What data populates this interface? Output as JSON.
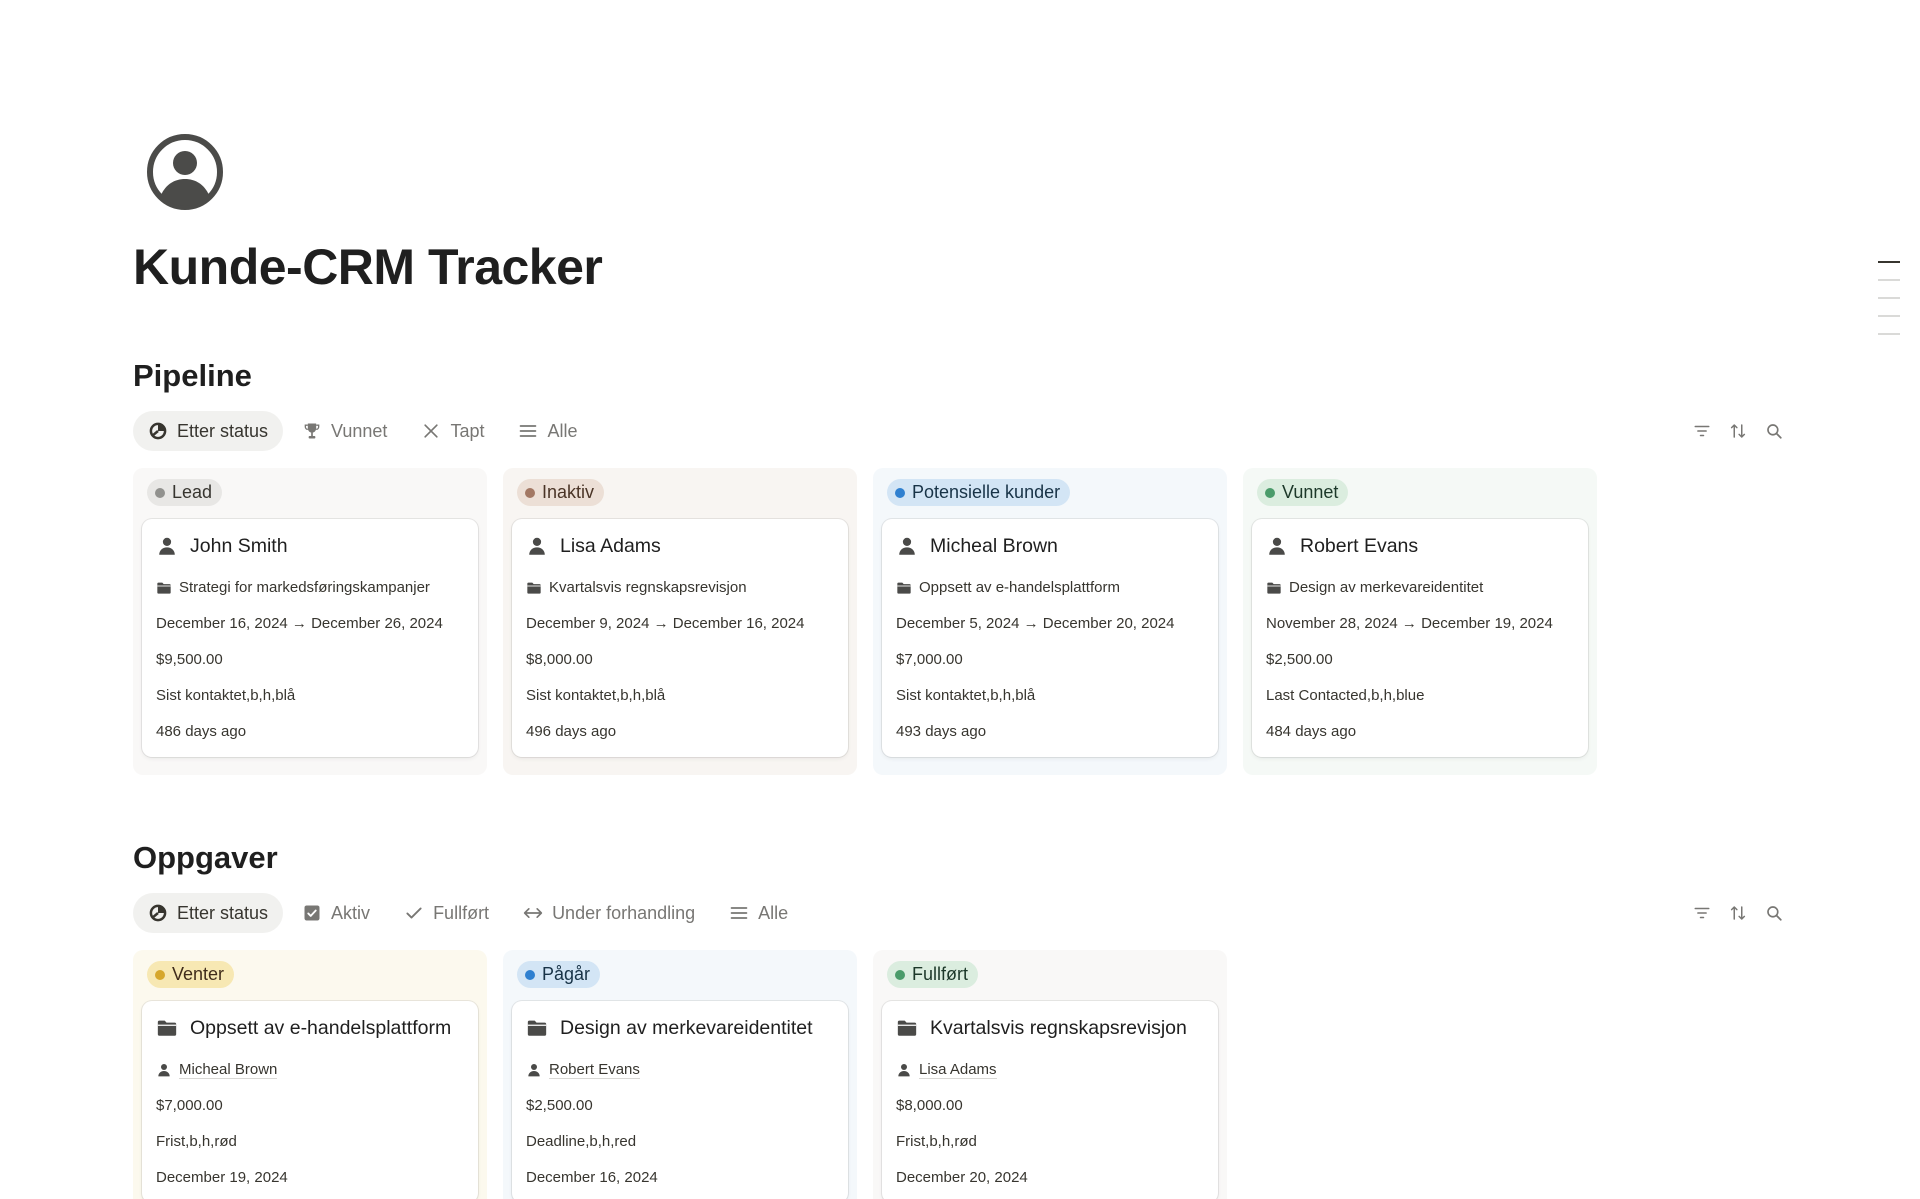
{
  "page": {
    "title": "Kunde-CRM Tracker",
    "icon": "user-circle-icon"
  },
  "pipeline": {
    "title": "Pipeline",
    "tabs": [
      {
        "label": "Etter status",
        "icon": "status-icon",
        "active": true
      },
      {
        "label": "Vunnet",
        "icon": "trophy-icon",
        "active": false
      },
      {
        "label": "Tapt",
        "icon": "x-icon",
        "active": false
      },
      {
        "label": "Alle",
        "icon": "list-icon",
        "active": false
      }
    ],
    "toolbar": [
      "filter-icon",
      "sort-icon",
      "search-icon"
    ],
    "columns": [
      {
        "label": "Lead",
        "color": "#91918e",
        "cards": [
          {
            "name": "John Smith",
            "project": "Strategi for markedsføringskampanjer",
            "dates": "December 16, 2024 → December 26, 2024",
            "value": "$9,500.00",
            "contact": "Sist kontaktet,b,h,blå",
            "age": "486 days ago"
          }
        ]
      },
      {
        "label": "Inaktiv",
        "color": "#a27763",
        "cards": [
          {
            "name": "Lisa Adams",
            "project": "Kvartalsvis regnskapsrevisjon",
            "dates": "December 9, 2024 → December 16, 2024",
            "value": "$8,000.00",
            "contact": "Sist kontaktet,b,h,blå",
            "age": "496 days ago"
          }
        ]
      },
      {
        "label": "Potensielle kunder",
        "color": "#2f80d0",
        "cards": [
          {
            "name": "Micheal Brown",
            "project": "Oppsett av e-handelsplattform",
            "dates": "December 5, 2024 → December 20, 2024",
            "value": "$7,000.00",
            "contact": "Sist kontaktet,b,h,blå",
            "age": "493 days ago"
          }
        ]
      },
      {
        "label": "Vunnet",
        "color": "#4a9b6a",
        "cards": [
          {
            "name": "Robert Evans",
            "project": "Design av merkevareidentitet",
            "dates": "November 28, 2024 → December 19, 2024",
            "value": "$2,500.00",
            "contact": "Last Contacted,b,h,blue",
            "age": "484 days ago"
          }
        ]
      }
    ]
  },
  "tasks": {
    "title": "Oppgaver",
    "tabs": [
      {
        "label": "Etter status",
        "icon": "status-icon",
        "active": true
      },
      {
        "label": "Aktiv",
        "icon": "checkbox-icon",
        "active": false
      },
      {
        "label": "Fullført",
        "icon": "check-icon",
        "active": false
      },
      {
        "label": "Under forhandling",
        "icon": "arrows-icon",
        "active": false
      },
      {
        "label": "Alle",
        "icon": "list-icon",
        "active": false
      }
    ],
    "toolbar": [
      "filter-icon",
      "sort-icon",
      "search-icon"
    ],
    "columns": [
      {
        "label": "Venter",
        "color": "#d6a72c",
        "cards": [
          {
            "name": "Oppsett av e-handelsplattform",
            "client": "Micheal Brown",
            "value": "$7,000.00",
            "deadline_label": "Frist,b,h,rød",
            "date": "December 19, 2024"
          }
        ]
      },
      {
        "label": "Pågår",
        "color": "#2f80d0",
        "cards": [
          {
            "name": "Design av merkevareidentitet",
            "client": "Robert Evans",
            "value": "$2,500.00",
            "deadline_label": "Deadline,b,h,red",
            "date": "December 16, 2024"
          }
        ]
      },
      {
        "label": "Fullført",
        "color": "#4a9b6a",
        "cards": [
          {
            "name": "Kvartalsvis regnskapsrevisjon",
            "client": "Lisa Adams",
            "value": "$8,000.00",
            "deadline_label": "Frist,b,h,rød",
            "date": "December 20, 2024"
          }
        ]
      }
    ]
  }
}
